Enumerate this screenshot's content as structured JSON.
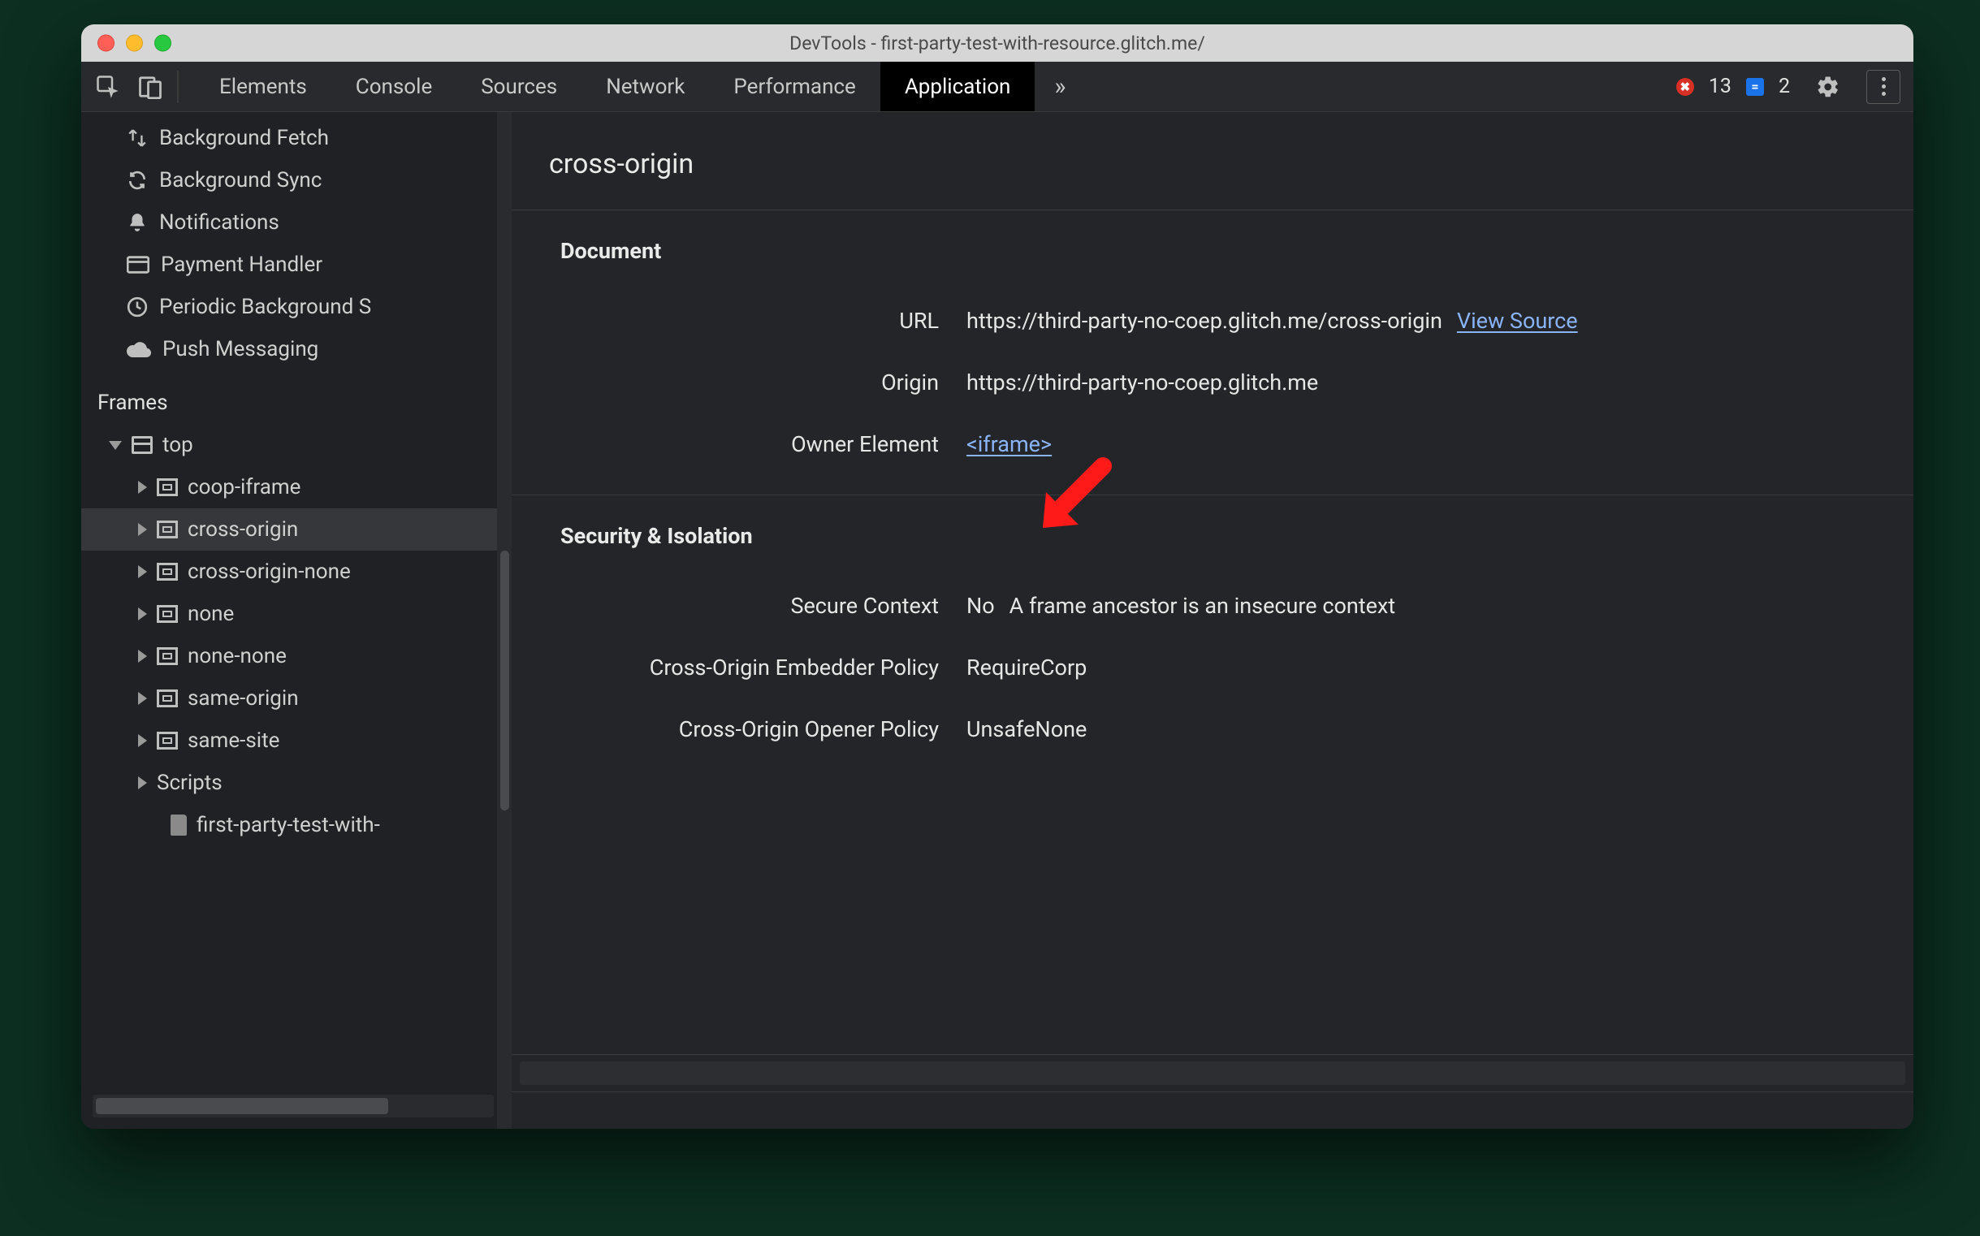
{
  "window": {
    "title": "DevTools - first-party-test-with-resource.glitch.me/"
  },
  "tabs": {
    "items": [
      {
        "label": "Elements",
        "active": false
      },
      {
        "label": "Console",
        "active": false
      },
      {
        "label": "Sources",
        "active": false
      },
      {
        "label": "Network",
        "active": false
      },
      {
        "label": "Performance",
        "active": false
      },
      {
        "label": "Application",
        "active": true
      }
    ],
    "overflow_glyph": "»",
    "errors_count": "13",
    "info_count": "2",
    "error_badge_glyph": "✖",
    "info_badge_glyph": "="
  },
  "sidebar": {
    "bg_services": [
      {
        "icon": "transfer",
        "label": "Background Fetch"
      },
      {
        "icon": "sync",
        "label": "Background Sync"
      },
      {
        "icon": "bell",
        "label": "Notifications"
      },
      {
        "icon": "card",
        "label": "Payment Handler"
      },
      {
        "icon": "clock",
        "label": "Periodic Background S"
      },
      {
        "icon": "cloud",
        "label": "Push Messaging"
      }
    ],
    "frames_heading": "Frames",
    "top_label": "top",
    "frame_nodes": [
      {
        "label": "coop-iframe",
        "selected": false
      },
      {
        "label": "cross-origin",
        "selected": true
      },
      {
        "label": "cross-origin-none",
        "selected": false
      },
      {
        "label": "none",
        "selected": false
      },
      {
        "label": "none-none",
        "selected": false
      },
      {
        "label": "same-origin",
        "selected": false
      },
      {
        "label": "same-site",
        "selected": false
      }
    ],
    "scripts_label": "Scripts",
    "file_label": "first-party-test-with-"
  },
  "main": {
    "title": "cross-origin",
    "sections": {
      "document": {
        "heading": "Document",
        "url_key": "URL",
        "url_value": "https://third-party-no-coep.glitch.me/cross-origin",
        "view_source": "View Source",
        "origin_key": "Origin",
        "origin_value": "https://third-party-no-coep.glitch.me",
        "owner_key": "Owner Element",
        "owner_link": "<iframe>"
      },
      "security": {
        "heading": "Security & Isolation",
        "secure_key": "Secure Context",
        "secure_no": "No",
        "secure_note": "A frame ancestor is an insecure context",
        "coep_key": "Cross-Origin Embedder Policy",
        "coep_value": "RequireCorp",
        "coop_key": "Cross-Origin Opener Policy",
        "coop_value": "UnsafeNone"
      }
    }
  },
  "annotation": {
    "color": "#ff1a1a"
  }
}
